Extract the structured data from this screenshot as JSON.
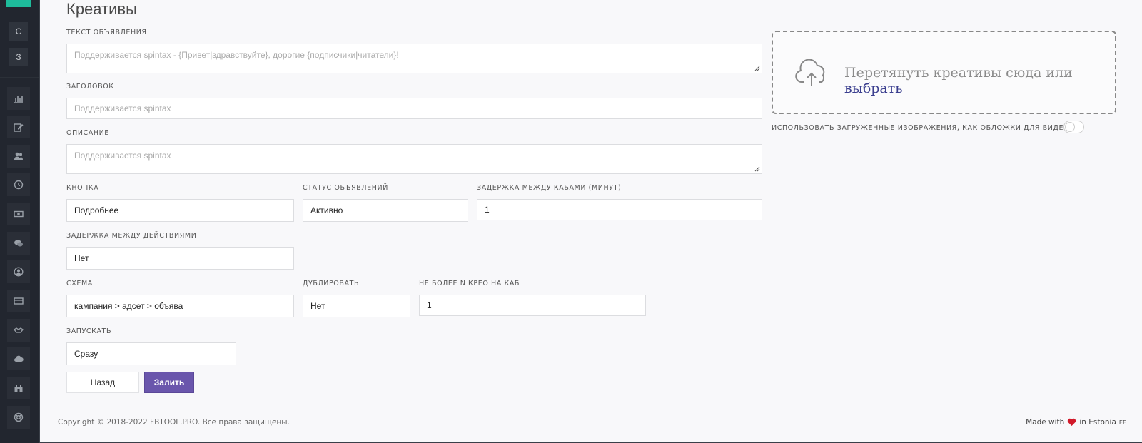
{
  "sidebar": {
    "letters": [
      "С",
      "З"
    ],
    "icons": [
      "bar-chart-icon",
      "edit-icon",
      "users-icon",
      "clock-icon",
      "money-icon",
      "chat-icon",
      "user-circle-icon",
      "credit-card-icon",
      "handshake-icon",
      "cloud-icon",
      "binoculars-icon",
      "lifebuoy-icon"
    ],
    "brand_color": "#1ebc9c"
  },
  "page": {
    "title": "Креативы"
  },
  "form": {
    "ad_text": {
      "label": "Текст объявления",
      "placeholder": "Поддерживается spintax - {Привет|здравствуйте}, дорогие {подписчики|читатели}!"
    },
    "headline": {
      "label": "Заголовок",
      "placeholder": "Поддерживается spintax"
    },
    "description": {
      "label": "Описание",
      "placeholder": "Поддерживается spintax"
    },
    "button": {
      "label": "Кнопка",
      "value": "Подробнее"
    },
    "ad_status": {
      "label": "Статус объявлений",
      "value": "Активно"
    },
    "delay_cabs": {
      "label": "Задержка между кабами (минут)",
      "value": "1"
    },
    "delay_actions": {
      "label": "Задержка между действиями",
      "value": "Нет"
    },
    "scheme": {
      "label": "Схема",
      "value": "кампания > адсет > объява"
    },
    "duplicate": {
      "label": "Дублировать",
      "value": "Нет"
    },
    "max_creos": {
      "label": "Не более N крео на каб",
      "value": "1"
    },
    "launch": {
      "label": "Запускать",
      "value": "Сразу"
    },
    "back_label": "Назад",
    "submit_label": "Залить",
    "submit_color": "#6a56ac"
  },
  "dropzone": {
    "text": "Перетянуть креативы сюда или ",
    "link": "выбрать",
    "toggle_label": "ИСПОЛЬЗОВАТЬ ЗАГРУЖЕННЫЕ ИЗОБРАЖЕНИЯ, КАК ОБЛОЖКИ ДЛЯ ВИДЕО?",
    "toggle_on": false
  },
  "footer": {
    "copyright": "Copyright © 2018-2022 FBTOOL.PRO. Все права защищены.",
    "made_with": "Made with",
    "in_country": "in Estonia",
    "country_code": "EE"
  }
}
